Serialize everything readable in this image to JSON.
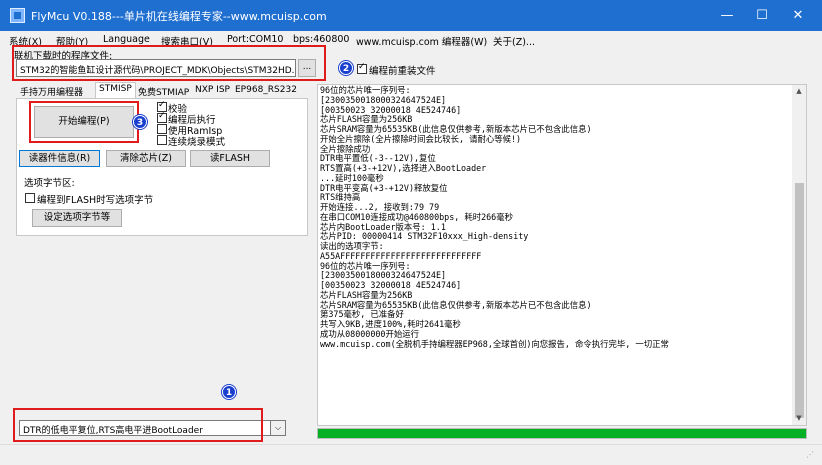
{
  "window": {
    "title": "FlyMcu V0.188---单片机在线编程专家--www.mcuisp.com",
    "minimize": "—",
    "maximize": "☐",
    "close": "✕"
  },
  "menu": {
    "items": [
      "系统(X)",
      "帮助(Y)",
      "Language",
      "搜索串口(V)",
      "Port:COM10",
      "bps:460800",
      "www.mcuisp.com 编程器(W)",
      "关于(Z)..."
    ]
  },
  "file_section": {
    "label": "联机下载时的程序文件:",
    "path": "STM32的智能鱼缸设计源代码\\PROJECT_MDK\\Objects\\STM32HD.hex",
    "browse_label": "...",
    "reload_label": "编程前重装文件",
    "reload_checked": true
  },
  "annotations": {
    "badge1": "1",
    "badge2": "2",
    "badge3": "3",
    "box_color": "#e01b1b",
    "badge_color": "#1a3fcf"
  },
  "tabs": [
    "手持万用编程器",
    "STMISP",
    "免费STMIAP",
    "NXP ISP",
    "EP968_RS232"
  ],
  "active_tab": "STMISP",
  "stmisp": {
    "start_button": "开始编程(P)",
    "options": [
      {
        "label": "校验",
        "checked": true
      },
      {
        "label": "编程后执行",
        "checked": true
      },
      {
        "label": "使用RamIsp",
        "checked": false
      },
      {
        "label": "连续烧录模式",
        "checked": false
      }
    ],
    "read_info_button": "读器件信息(R)",
    "clear_chip_button": "清除芯片(Z)",
    "read_flash_button": "读FLASH",
    "option_bytes_label": "选项字节区:",
    "write_option_label": "编程到FLASH时写选项字节",
    "write_option_checked": false,
    "set_option_button": "设定选项字节等"
  },
  "boot_mode": {
    "selected": "DTR的低电平复位,RTS高电平进BootLoader",
    "arrow": "⌵"
  },
  "log": [
    "96位的芯片唯一序列号:",
    "[2300350018000324647524E]",
    "[00350023 32000018 4E524746]",
    "芯片FLASH容量为256KB",
    "芯片SRAM容量为65535KB(此信息仅供参考,新版本芯片已不包含此信息)",
    "开始全片擦除(全片擦除时间会比较长, 请耐心等候!)",
    "全片擦除成功",
    "DTR电平置低(-3--12V),复位",
    "RTS置高(+3-+12V),选择进入BootLoader",
    "...延时100毫秒",
    "DTR电平变高(+3-+12V)释放复位",
    "RTS维持高",
    "开始连接...2, 接收到:79 79",
    "在串口COM10连接成功@460800bps, 耗时266毫秒",
    "芯片内BootLoader版本号: 1.1",
    "芯片PID: 00000414  STM32F10xxx_High-density",
    "读出的选项字节:",
    "A55AFFFFFFFFFFFFFFFFFFFFFFFFFFFF",
    "96位的芯片唯一序列号:",
    "[2300350018000324647524E]",
    "[00350023 32000018 4E524746]",
    "芯片FLASH容量为256KB",
    "芯片SRAM容量为65535KB(此信息仅供参考,新版本芯片已不包含此信息)",
    "第375毫秒, 已准备好",
    "共写入9KB,进度100%,耗时2641毫秒",
    "成功从08000000开始运行",
    "www.mcuisp.com(全脱机手持编程器EP968,全球首创)向您报告, 命令执行完毕, 一切正常"
  ],
  "progress": {
    "percent": 100,
    "color": "#06b025"
  },
  "scroll": {
    "up": "▲",
    "down": "▼"
  },
  "status": {
    "grip": "⋰"
  }
}
